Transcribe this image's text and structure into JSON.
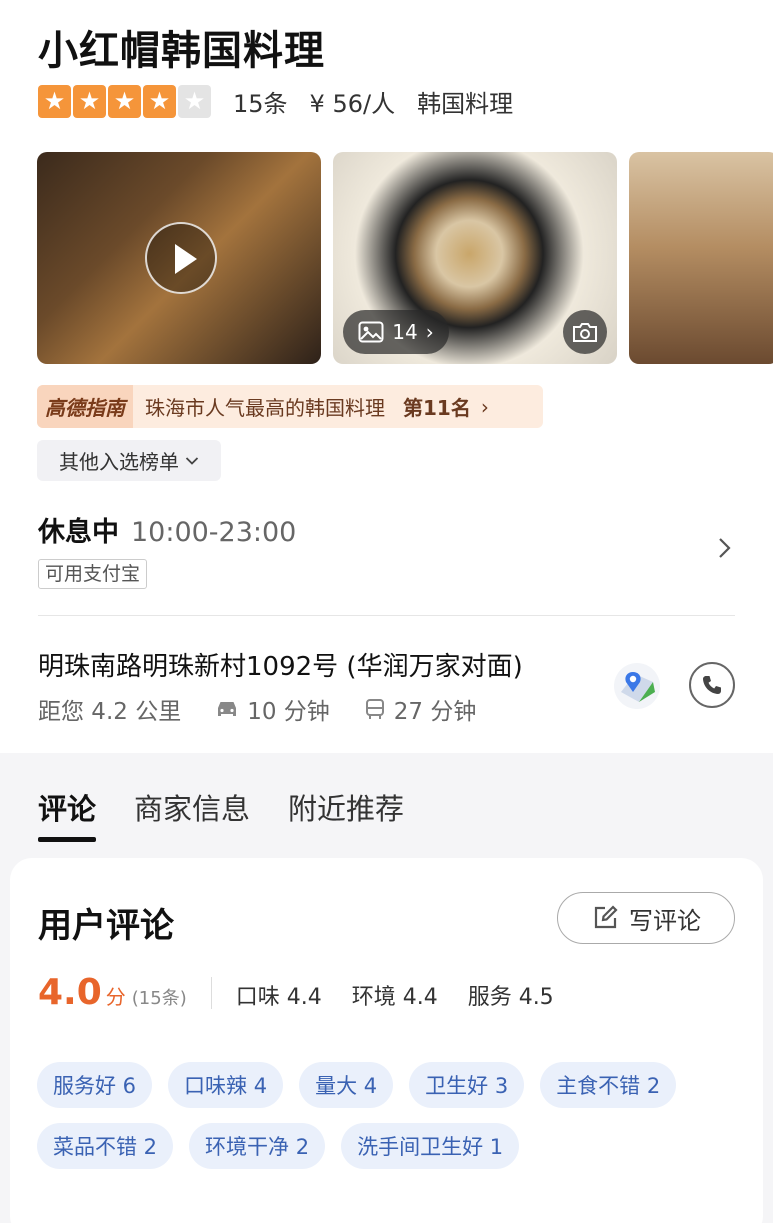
{
  "restaurant": {
    "name": "小红帽韩国料理",
    "rating_stars": 4,
    "rating_stars_max": 5,
    "review_count": "15条",
    "price": "¥ 56/人",
    "category": "韩国料理"
  },
  "photos": {
    "count": "14"
  },
  "ranking": {
    "brand": "高德指南",
    "text": "珠海市人气最高的韩国料理",
    "position": "第11名"
  },
  "other_lists": {
    "label": "其他入选榜单"
  },
  "business": {
    "status": "休息中",
    "hours": "10:00-23:00",
    "payment": "可用支付宝"
  },
  "location": {
    "address": "明珠南路明珠新村1092号 (华润万家对面)",
    "distance": "距您 4.2 公里",
    "drive_time": "10 分钟",
    "bus_time": "27 分钟"
  },
  "tabs": [
    {
      "label": "评论",
      "active": true
    },
    {
      "label": "商家信息",
      "active": false
    },
    {
      "label": "附近推荐",
      "active": false
    }
  ],
  "reviews": {
    "title": "用户评论",
    "write_label": "写评论",
    "score": "4.0",
    "score_unit": "分",
    "score_count": "(15条)",
    "taste": "口味 4.4",
    "environment": "环境 4.4",
    "service": "服务 4.5",
    "tags": [
      "服务好 6",
      "口味辣 4",
      "量大 4",
      "卫生好 3",
      "主食不错 2",
      "菜品不错 2",
      "环境干净 2",
      "洗手间卫生好 1"
    ]
  },
  "colors": {
    "star": "#f5953a",
    "score": "#e8652b",
    "tag_text": "#3a62b3",
    "tag_bg": "#eaf0fb"
  }
}
